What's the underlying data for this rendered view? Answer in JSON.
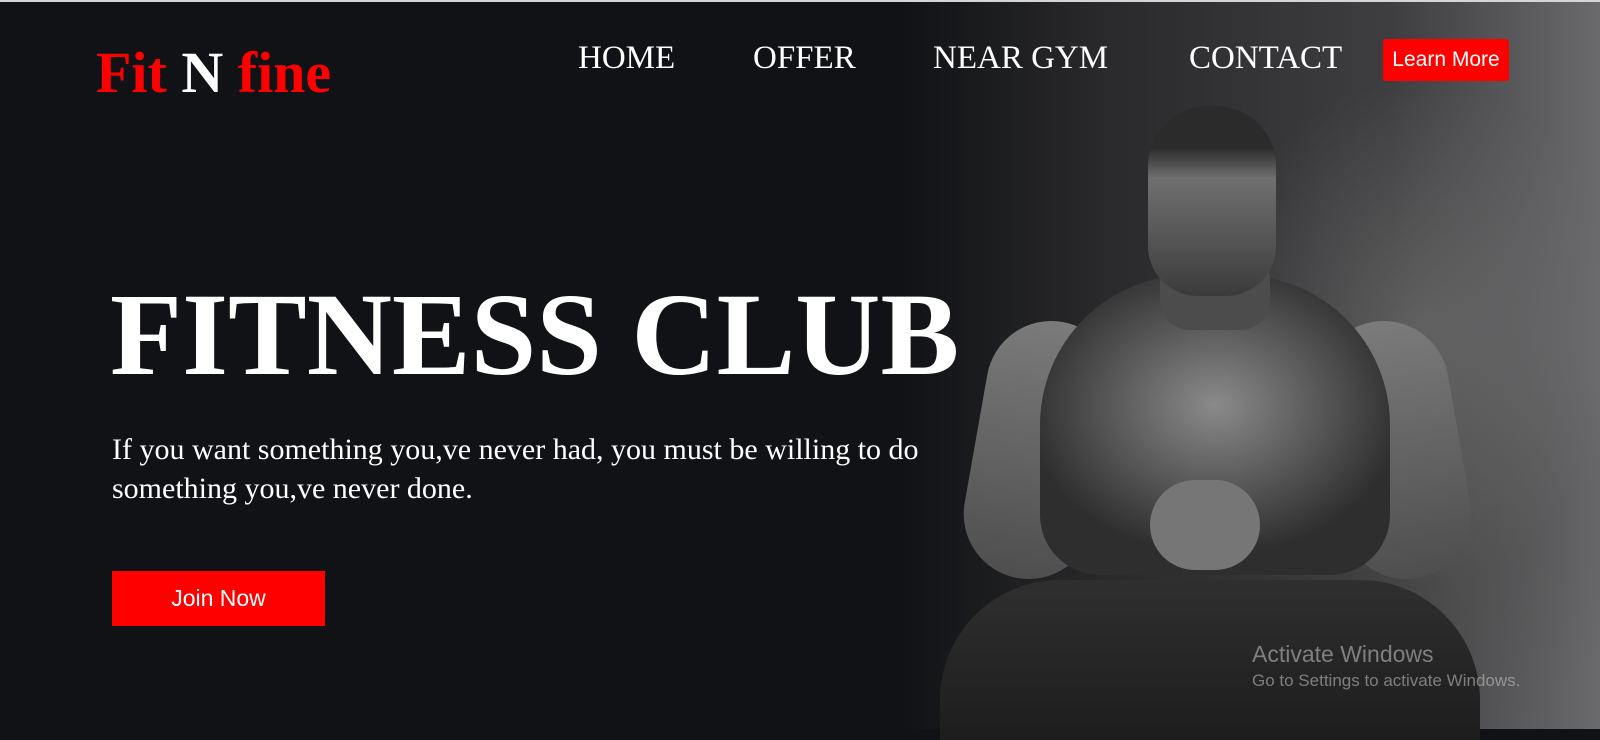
{
  "header": {
    "logo": {
      "part1": "Fit",
      "part2": "N",
      "part3": "fine"
    },
    "nav": [
      "HOME",
      "OFFER",
      "NEAR GYM",
      "CONTACT"
    ],
    "cta_label": "Learn More"
  },
  "hero": {
    "title": "FITNESS CLUB",
    "tagline": "If you want something you,ve never had, you must be willing to do something you,ve never done.",
    "button_label": "Join Now"
  },
  "watermark": {
    "title": "Activate Windows",
    "subtitle": "Go to Settings to activate Windows."
  },
  "colors": {
    "background": "#111215",
    "accent": "#ff0000",
    "text": "#ffffff"
  }
}
